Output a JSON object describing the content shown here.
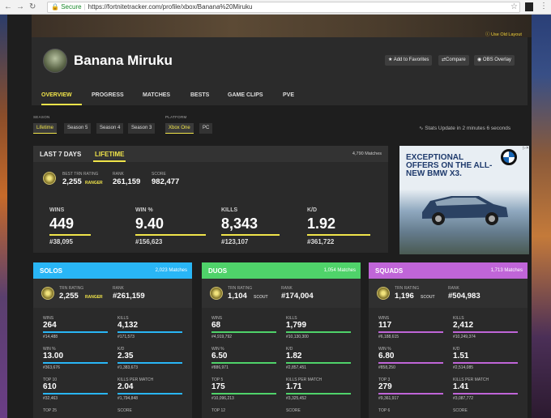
{
  "browser": {
    "url_secure": "Secure",
    "url": "https://fortnitetracker.com/profile/xbox/Banana%20Miruku"
  },
  "banner": {
    "old_layout": "Use Old Layout"
  },
  "profile": {
    "name": "Banana Miruku",
    "buttons": [
      "Add to Favorites",
      "Compare",
      "OBS Overlay"
    ],
    "tabs": [
      "OVERVIEW",
      "PROGRESS",
      "MATCHES",
      "BESTS",
      "GAME CLIPS",
      "PVE"
    ]
  },
  "filters": {
    "season_label": "SEASON",
    "season_options": [
      "Lifetime",
      "Season 5",
      "Season 4",
      "Season 3"
    ],
    "platform_label": "PLATFORM",
    "platform_options": [
      "Xbox One",
      "PC"
    ],
    "update_text": "Stats Update in 2 minutes 6 seconds"
  },
  "overall": {
    "tabs": [
      "LAST 7 DAYS",
      "LIFETIME"
    ],
    "matches": "4,790 Matches",
    "best_trn_label": "BEST TRN RATING",
    "best_trn_value": "2,255",
    "best_trn_tier": "RANGER",
    "rank_label": "RANK",
    "rank_value": "261,159",
    "score_label": "SCORE",
    "score_value": "982,477",
    "stats": [
      {
        "label": "WINS",
        "value": "449",
        "rank": "#38,095",
        "fill": 0.55
      },
      {
        "label": "WIN %",
        "value": "9.40",
        "rank": "#156,623",
        "fill": 0.95
      },
      {
        "label": "KILLS",
        "value": "8,343",
        "rank": "#123,107",
        "fill": 0.78
      },
      {
        "label": "K/D",
        "value": "1.92",
        "rank": "#361,722",
        "fill": 0.85
      }
    ]
  },
  "ad": {
    "headline": "EXCEPTIONAL OFFERS ON THE ALL-NEW BMW X3.",
    "tagline": "The Ultimate Driving Machine"
  },
  "modes": [
    {
      "title": "SOLOS",
      "matches": "2,023 Matches",
      "color": "#29b6f6",
      "trn_label": "TRN RATING",
      "trn_value": "2,255",
      "tier": "RANGER",
      "rank_label": "RANK",
      "rank_value": "#261,159",
      "stats": [
        {
          "label": "WINS",
          "value": "264",
          "rank": "#14,488"
        },
        {
          "label": "KILLS",
          "value": "4,132",
          "rank": "#171,573"
        },
        {
          "label": "WIN %",
          "value": "13.00",
          "rank": "#363,676"
        },
        {
          "label": "K/D",
          "value": "2.35",
          "rank": "#1,383,673"
        },
        {
          "label": "TOP 10",
          "value": "610",
          "rank": "#32,463"
        },
        {
          "label": "KILLS PER MATCH",
          "value": "2.04",
          "rank": "#1,794,848"
        },
        {
          "label": "TOP 25",
          "value": "",
          "rank": ""
        },
        {
          "label": "SCORE",
          "value": "",
          "rank": ""
        }
      ]
    },
    {
      "title": "DUOS",
      "matches": "1,054 Matches",
      "color": "#4fd36a",
      "trn_label": "TRN RATING",
      "trn_value": "1,104",
      "tier": "SCOUT",
      "rank_label": "RANK",
      "rank_value": "#174,004",
      "stats": [
        {
          "label": "WINS",
          "value": "68",
          "rank": "#4,919,792"
        },
        {
          "label": "KILLS",
          "value": "1,799",
          "rank": "#10,130,300"
        },
        {
          "label": "WIN %",
          "value": "6.50",
          "rank": "#886,971"
        },
        {
          "label": "K/D",
          "value": "1.82",
          "rank": "#2,857,451"
        },
        {
          "label": "TOP 5",
          "value": "175",
          "rank": "#10,096,213"
        },
        {
          "label": "KILLS PER MATCH",
          "value": "1.71",
          "rank": "#3,325,452"
        },
        {
          "label": "TOP 12",
          "value": "",
          "rank": ""
        },
        {
          "label": "SCORE",
          "value": "",
          "rank": ""
        }
      ]
    },
    {
      "title": "SQUADS",
      "matches": "1,713 Matches",
      "color": "#c065d8",
      "trn_label": "TRN RATING",
      "trn_value": "1,196",
      "tier": "SCOUT",
      "rank_label": "RANK",
      "rank_value": "#504,983",
      "stats": [
        {
          "label": "WINS",
          "value": "117",
          "rank": "#6,188,615"
        },
        {
          "label": "KILLS",
          "value": "2,412",
          "rank": "#10,249,374"
        },
        {
          "label": "WIN %",
          "value": "6.80",
          "rank": "#858,250"
        },
        {
          "label": "K/D",
          "value": "1.51",
          "rank": "#2,514,085"
        },
        {
          "label": "TOP 3",
          "value": "279",
          "rank": "#9,361,917"
        },
        {
          "label": "KILLS PER MATCH",
          "value": "1.41",
          "rank": "#3,087,772"
        },
        {
          "label": "TOP 6",
          "value": "",
          "rank": ""
        },
        {
          "label": "SCORE",
          "value": "",
          "rank": ""
        }
      ]
    }
  ]
}
